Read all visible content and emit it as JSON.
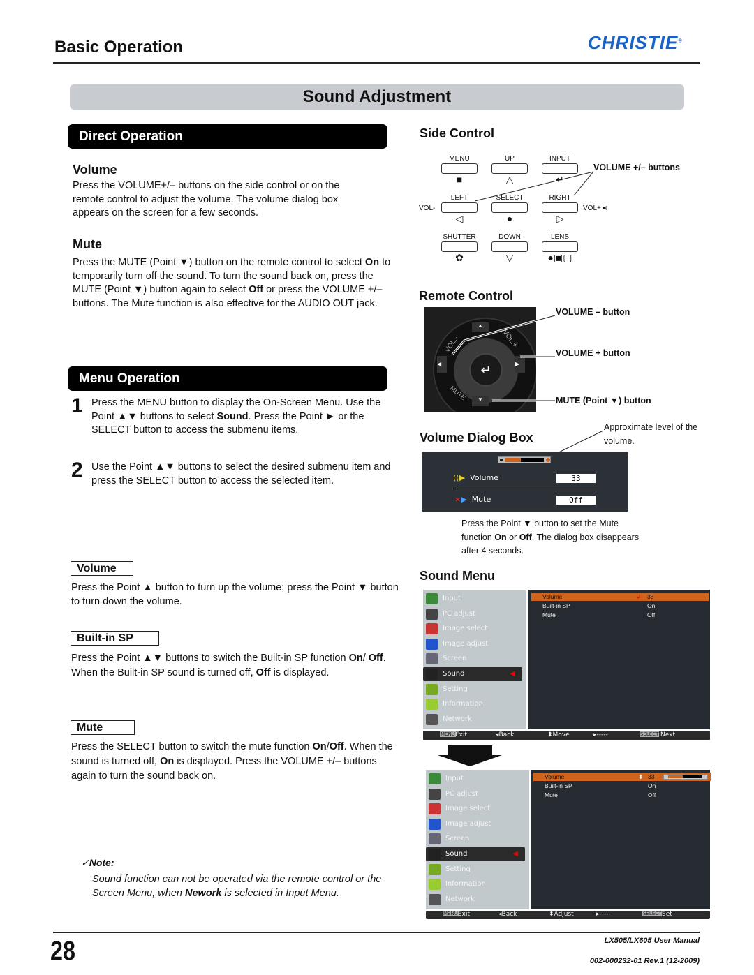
{
  "header": {
    "section": "Basic Operation",
    "logo": "CHRISTIE",
    "logo_mark": "®"
  },
  "page_title": "Sound Adjustment",
  "direct_operation": {
    "heading": "Direct Operation",
    "volume": {
      "title": "Volume",
      "text": "Press the VOLUME+/– buttons on the side control or on the remote control to adjust the volume. The volume dialog box appears on the screen for a few seconds."
    },
    "mute": {
      "title": "Mute",
      "text_parts": [
        "Press the MUTE (Point ▼) button on the remote control to select ",
        "On",
        " to temporarily turn off the sound. To turn the sound back on, press the MUTE (Point ▼) button again to select ",
        "Off",
        " or press the VOLUME +/– buttons. The Mute function is also effective for the AUDIO OUT jack."
      ]
    }
  },
  "menu_operation": {
    "heading": "Menu Operation",
    "steps": [
      {
        "num": "1",
        "parts": [
          "Press the MENU button to display the On-Screen Menu. Use the Point ▲▼ buttons to select ",
          "Sound",
          ". Press the Point ► or the SELECT button to access the submenu items."
        ]
      },
      {
        "num": "2",
        "parts": [
          "Use the Point ▲▼ buttons to select the desired submenu item and press the SELECT button to access the selected item."
        ]
      }
    ],
    "items": [
      {
        "label": "Volume",
        "text_parts": [
          "Press the Point ▲ button to turn up the volume; press the  Point ▼ button to turn down the volume."
        ]
      },
      {
        "label": "Built-in SP",
        "text_parts": [
          "Press the Point ▲▼ buttons to switch the Built-in SP function ",
          "On",
          "/ ",
          "Off",
          ". When the Built-in SP sound is turned off, ",
          "Off",
          " is displayed."
        ]
      },
      {
        "label": "Mute",
        "text_parts": [
          "Press the SELECT button to switch the mute function ",
          "On",
          "/",
          "Off",
          ". When the sound is turned off, ",
          "On",
          " is displayed. Press the VOLUME +/– buttons again to turn the sound back on."
        ]
      }
    ],
    "note": {
      "title": "Note:",
      "check": "✓",
      "parts": [
        "Sound function can not be operated via the remote control or the Screen Menu, when ",
        "Nework",
        " is selected in Input Menu."
      ]
    }
  },
  "side_control": {
    "title": "Side Control",
    "buttons": [
      {
        "label": "MENU",
        "icon": "■"
      },
      {
        "label": "UP",
        "icon": "△"
      },
      {
        "label": "INPUT",
        "icon": "↵"
      },
      {
        "label": "LEFT",
        "icon": "◁"
      },
      {
        "label": "SELECT",
        "icon": "●"
      },
      {
        "label": "RIGHT",
        "icon": "▷"
      },
      {
        "label": "SHUTTER",
        "icon": "✿"
      },
      {
        "label": "DOWN",
        "icon": "▽"
      },
      {
        "label": "LENS",
        "icon": "●▣▢"
      }
    ],
    "vol_minus": "VOL-",
    "vol_plus": "VOL+",
    "callout": "VOLUME +/– buttons"
  },
  "remote_control": {
    "title": "Remote Control",
    "callouts": [
      "VOLUME – button",
      "VOLUME + button",
      "MUTE (Point ▼) button"
    ],
    "labels": {
      "vol_minus": "VOL.-",
      "vol_plus": "VOL.+",
      "mute": "MUTE",
      "enter": "↵"
    }
  },
  "volume_dialog": {
    "title": "Volume Dialog Box",
    "callout_top": "Approximate level of the volume.",
    "level_fraction": 0.33,
    "rows": [
      {
        "label": "Volume",
        "value": "33"
      },
      {
        "label": "Mute",
        "value": "Off"
      }
    ],
    "caption_parts": [
      "Press the Point ▼ button to set the Mute function ",
      "On",
      " or ",
      "Off",
      ". The dialog box disappears after 4 seconds."
    ]
  },
  "sound_menu": {
    "title": "Sound Menu",
    "main_items": [
      "Input",
      "PC adjust",
      "Image select",
      "Image adjust",
      "Screen",
      "Sound",
      "Setting",
      "Information",
      "Network"
    ],
    "selected": "Sound",
    "screen1": {
      "sub_rows": [
        {
          "label": "Volume",
          "value": "33"
        },
        {
          "label": "Built-in SP",
          "value": "On"
        },
        {
          "label": "Mute",
          "value": "Off"
        }
      ],
      "bar": {
        "menu": "MENU",
        "exit": "Exit",
        "back": "◂Back",
        "move": "⬍Move",
        "dash": "▸-----",
        "select": "SELECT",
        "next": "Next"
      }
    },
    "screen2": {
      "sub_rows": [
        {
          "label": "Volume",
          "value": "33"
        },
        {
          "label": "Built-in SP",
          "value": "On"
        },
        {
          "label": "Mute",
          "value": "Off"
        }
      ],
      "level_fraction": 0.33,
      "bar": {
        "menu": "MENU",
        "exit": "Exit",
        "back": "◂Back",
        "adjust": "⬍Adjust",
        "dash": "▸-----",
        "select": "SELECT",
        "set": "Set"
      }
    }
  },
  "footer": {
    "page_number": "28",
    "manual": "LX505/LX605 User Manual",
    "doc_id": "002-000232-01 Rev.1 (12-2009)"
  },
  "colors": {
    "logo_blue": "#1763c7",
    "osd_orange": "#d0641c",
    "title_bar_gray": "#c8ccd0"
  }
}
